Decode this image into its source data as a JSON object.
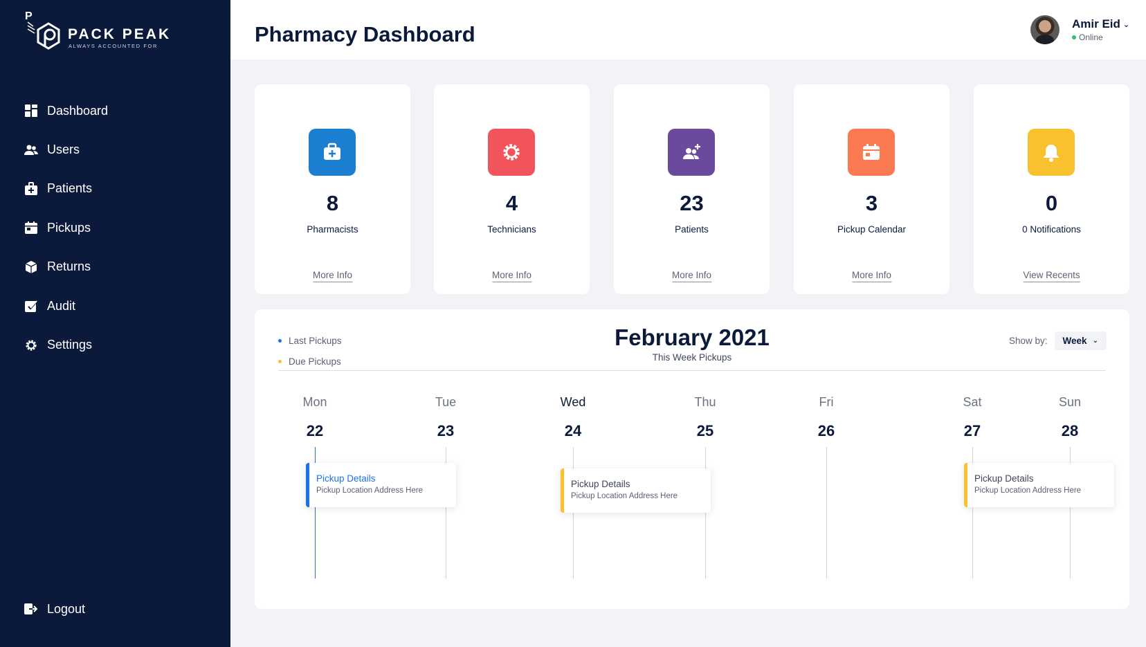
{
  "brand": {
    "name": "PACK PEAK",
    "tagline": "ALWAYS ACCOUNTED FOR"
  },
  "sidebar": {
    "items": [
      {
        "label": "Dashboard",
        "icon": "dashboard-icon"
      },
      {
        "label": "Users",
        "icon": "users-icon"
      },
      {
        "label": "Patients",
        "icon": "medical-kit-icon"
      },
      {
        "label": "Pickups",
        "icon": "calendar-icon"
      },
      {
        "label": "Returns",
        "icon": "box-icon"
      },
      {
        "label": "Audit",
        "icon": "edit-check-icon"
      },
      {
        "label": "Settings",
        "icon": "gear-icon"
      }
    ],
    "logout_label": "Logout"
  },
  "header": {
    "title": "Pharmacy Dashboard",
    "user_name": "Amir Eid",
    "user_status": "Online"
  },
  "cards": [
    {
      "value": "8",
      "label": "Pharmacists",
      "link": "More Info",
      "color": "#1b7fd1",
      "icon": "medical-kit-icon"
    },
    {
      "value": "4",
      "label": "Technicians",
      "link": "More Info",
      "color": "#f2545b",
      "icon": "gear-icon"
    },
    {
      "value": "23",
      "label": "Patients",
      "link": "More Info",
      "color": "#6a4a9c",
      "icon": "add-user-icon"
    },
    {
      "value": "3",
      "label": "Pickup Calendar",
      "link": "More Info",
      "color": "#fb7a52",
      "icon": "calendar-icon"
    },
    {
      "value": "0",
      "label": "0 Notifications",
      "link": "View Recents",
      "color": "#f9c12e",
      "icon": "bell-icon"
    }
  ],
  "calendar": {
    "legend": [
      {
        "label": "Last Pickups",
        "color": "#1b73e8"
      },
      {
        "label": "Due Pickups",
        "color": "#f9c12e"
      }
    ],
    "month": "February 2021",
    "subtitle": "This Week Pickups",
    "show_by_label": "Show by:",
    "show_by_value": "Week",
    "days": [
      {
        "name": "Mon",
        "num": "22"
      },
      {
        "name": "Tue",
        "num": "23"
      },
      {
        "name": "Wed",
        "num": "24"
      },
      {
        "name": "Thu",
        "num": "25"
      },
      {
        "name": "Fri",
        "num": "26"
      },
      {
        "name": "Sat",
        "num": "27"
      },
      {
        "name": "Sun",
        "num": "28"
      }
    ],
    "events": [
      {
        "title": "Pickup Details",
        "address": "Pickup Location Address Here",
        "color": "#1b73e8",
        "day": "Mon"
      },
      {
        "title": "Pickup Details",
        "address": "Pickup Location Address Here",
        "color": "#f9c12e",
        "day": "Wed"
      },
      {
        "title": "Pickup Details",
        "address": "Pickup Location Address Here",
        "color": "#f9c12e",
        "day": "Sat"
      }
    ]
  }
}
